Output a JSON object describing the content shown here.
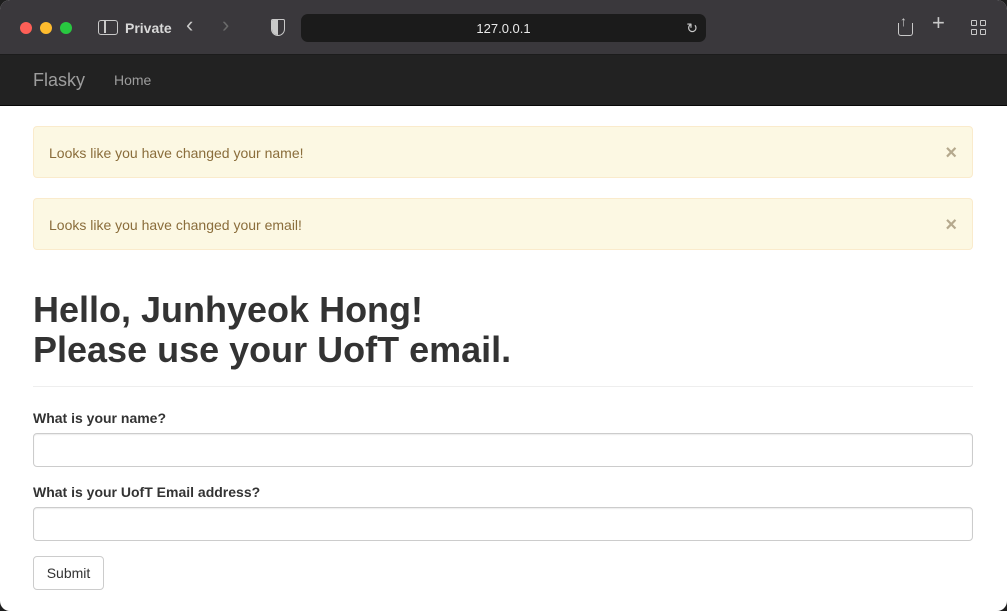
{
  "browser": {
    "private_label": "Private",
    "url": "127.0.0.1"
  },
  "navbar": {
    "brand": "Flasky",
    "home": "Home"
  },
  "alerts": [
    {
      "message": "Looks like you have changed your name!",
      "close": "×"
    },
    {
      "message": "Looks like you have changed your email!",
      "close": "×"
    }
  ],
  "header": {
    "line1": "Hello, Junhyeok Hong!",
    "line2": "Please use your UofT email."
  },
  "form": {
    "name_label": "What is your name?",
    "name_value": "",
    "email_label": "What is your UofT Email address?",
    "email_value": "",
    "submit_label": "Submit"
  },
  "colors": {
    "navbar_bg": "#222222",
    "alert_bg": "#fcf8e3",
    "alert_text": "#8a6d3b"
  }
}
